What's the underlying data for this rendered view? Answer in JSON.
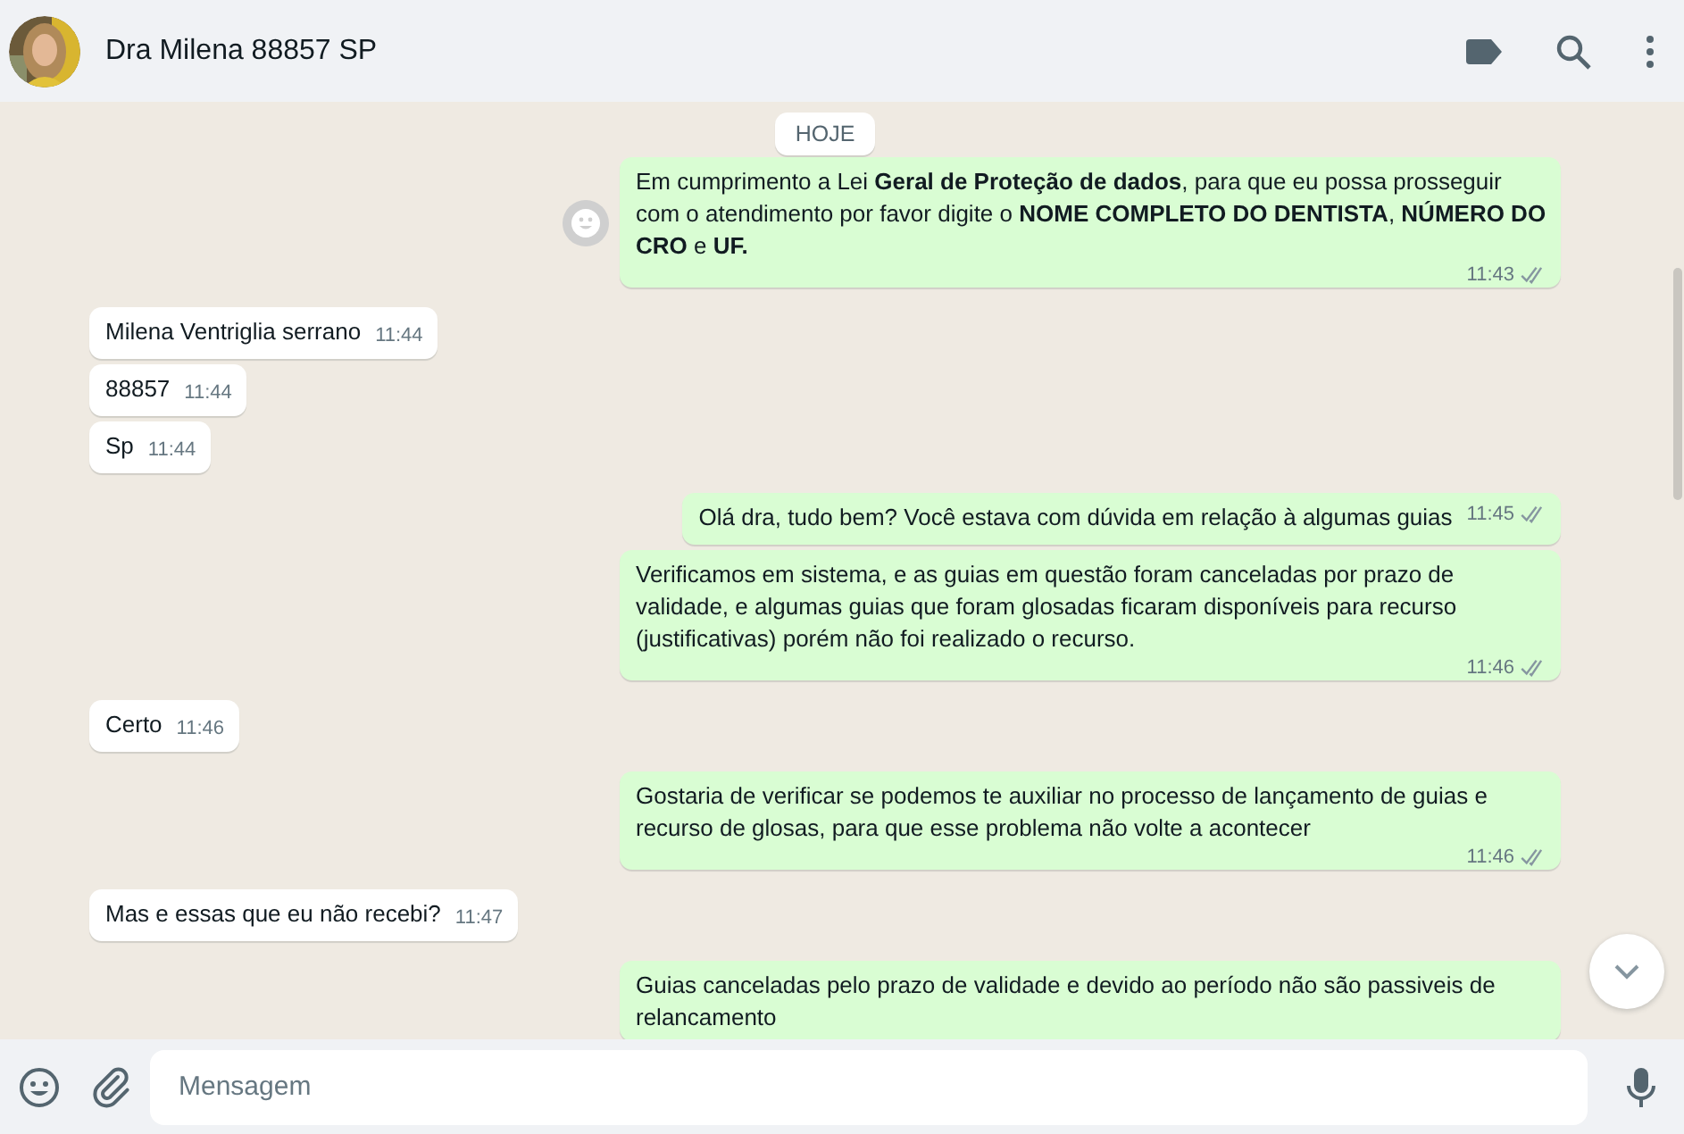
{
  "header": {
    "contact_name": "Dra Milena 88857 SP"
  },
  "date_badge": "HOJE",
  "messages": [
    {
      "kind": "out",
      "text": "Em cumprimento a Lei **Geral de Proteção de dados**, para que eu possa prosseguir com o atendimento por favor digite o **NOME COMPLETO DO DENTISTA**, **NÚMERO DO CRO** e **UF.**",
      "time": "11:43",
      "reaction_button": true
    },
    {
      "kind": "in",
      "text": "Milena Ventriglia serrano",
      "time": "11:44"
    },
    {
      "kind": "in",
      "text": "88857",
      "time": "11:44"
    },
    {
      "kind": "in",
      "text": "Sp",
      "time": "11:44"
    },
    {
      "kind": "out",
      "text": "Olá dra, tudo bem? Você estava com dúvida em relação à  algumas guias",
      "time": "11:45"
    },
    {
      "kind": "out",
      "text": "Verificamos em sistema, e as guias em questão foram canceladas por prazo de validade, e algumas guias que foram glosadas ficaram disponíveis para recurso (justificativas) porém não foi realizado o recurso.",
      "time": "11:46"
    },
    {
      "kind": "in",
      "text": "Certo",
      "time": "11:46"
    },
    {
      "kind": "out",
      "text": "Gostaria de verificar se podemos te auxiliar no processo de lançamento de guias e recurso de glosas, para que esse problema não volte a acontecer",
      "time": "11:46"
    },
    {
      "kind": "in",
      "text": "Mas e essas que eu não recebi?",
      "time": "11:47"
    },
    {
      "kind": "out",
      "text": "Guias canceladas pelo prazo de validade e devido ao período não são passiveis de relancamento"
    }
  ],
  "composer": {
    "placeholder": "Mensagem"
  }
}
